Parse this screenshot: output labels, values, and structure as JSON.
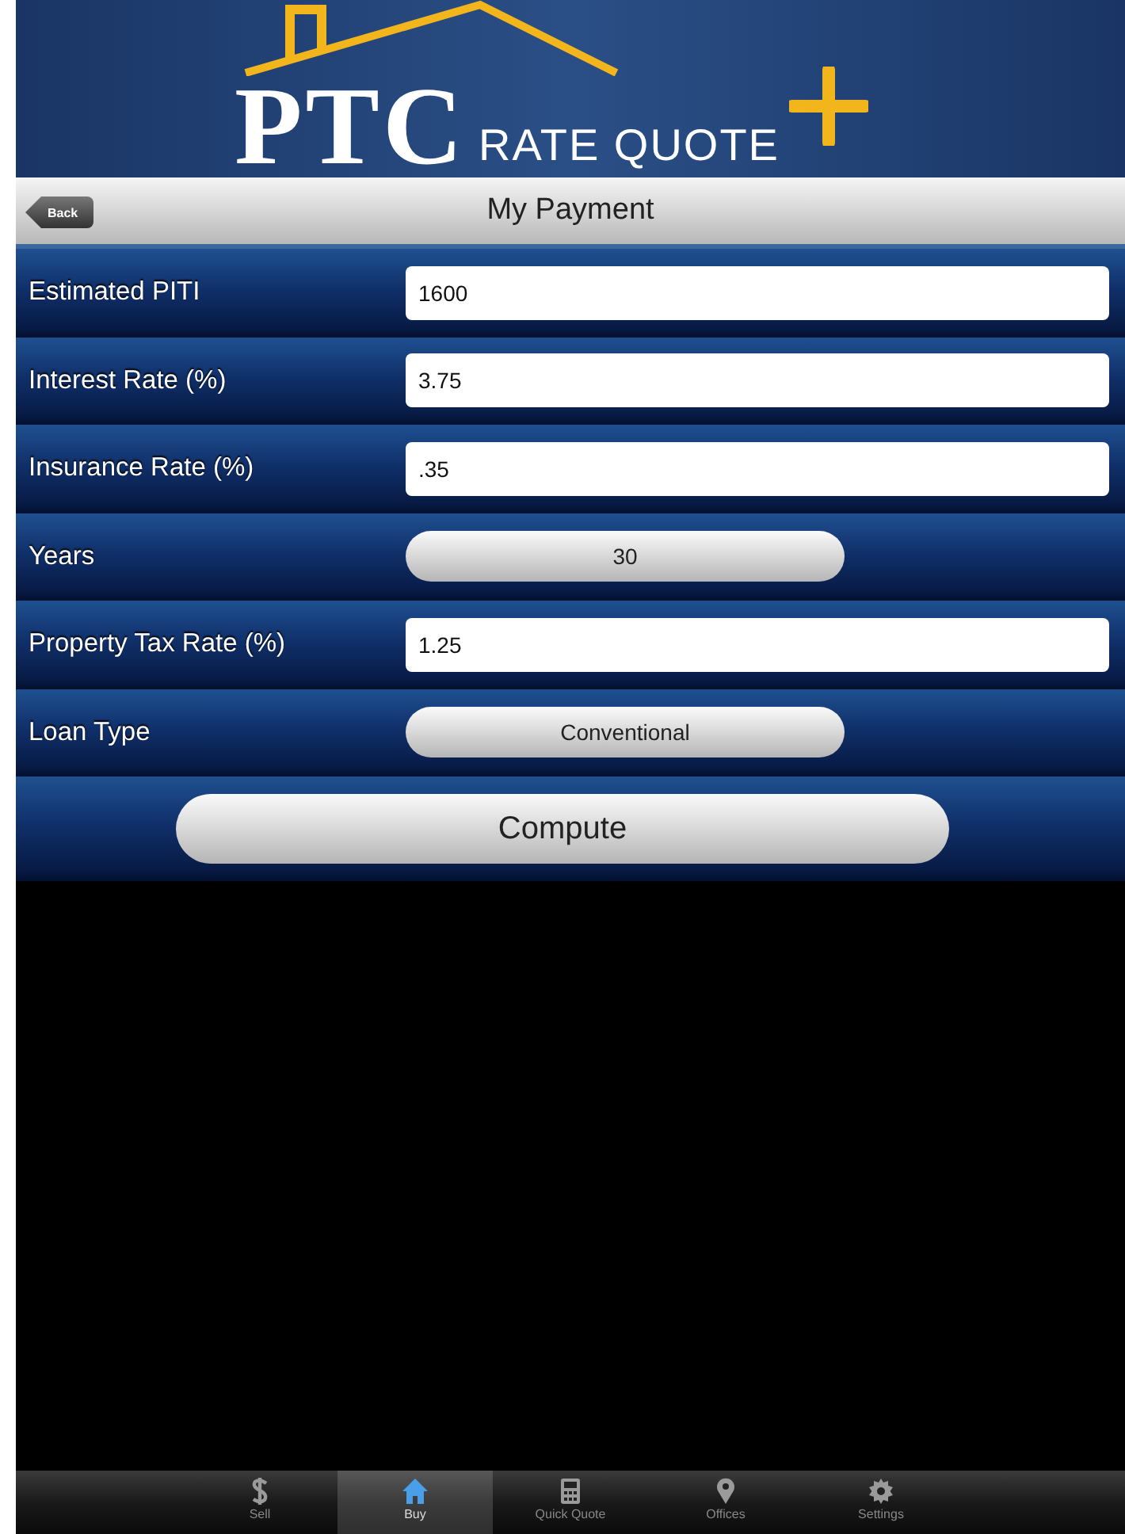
{
  "header": {
    "logo_mark": "PTC",
    "logo_text": "RATE QUOTE"
  },
  "nav_bar": {
    "back": "Back",
    "title": "My Payment"
  },
  "rows": [
    {
      "kind": "field",
      "label": "Estimated PITI",
      "value": "1600"
    },
    {
      "kind": "field",
      "label": "Interest Rate (%)",
      "value": "3.75"
    },
    {
      "kind": "field",
      "label": "Insurance Rate (%)",
      "value": ".35"
    },
    {
      "kind": "picker",
      "label": "Years",
      "value": "30"
    },
    {
      "kind": "field",
      "label": "Property Tax Rate (%)",
      "value": "1.25"
    },
    {
      "kind": "picker",
      "label": "Loan Type",
      "value": "Conventional"
    }
  ],
  "compute_button": "Compute",
  "tab_bar": [
    {
      "label": "Sell",
      "selected": false
    },
    {
      "label": "Buy",
      "selected": true
    },
    {
      "label": "Quick Quote",
      "selected": false
    },
    {
      "label": "Offices",
      "selected": false
    },
    {
      "label": "Settings",
      "selected": false
    }
  ]
}
